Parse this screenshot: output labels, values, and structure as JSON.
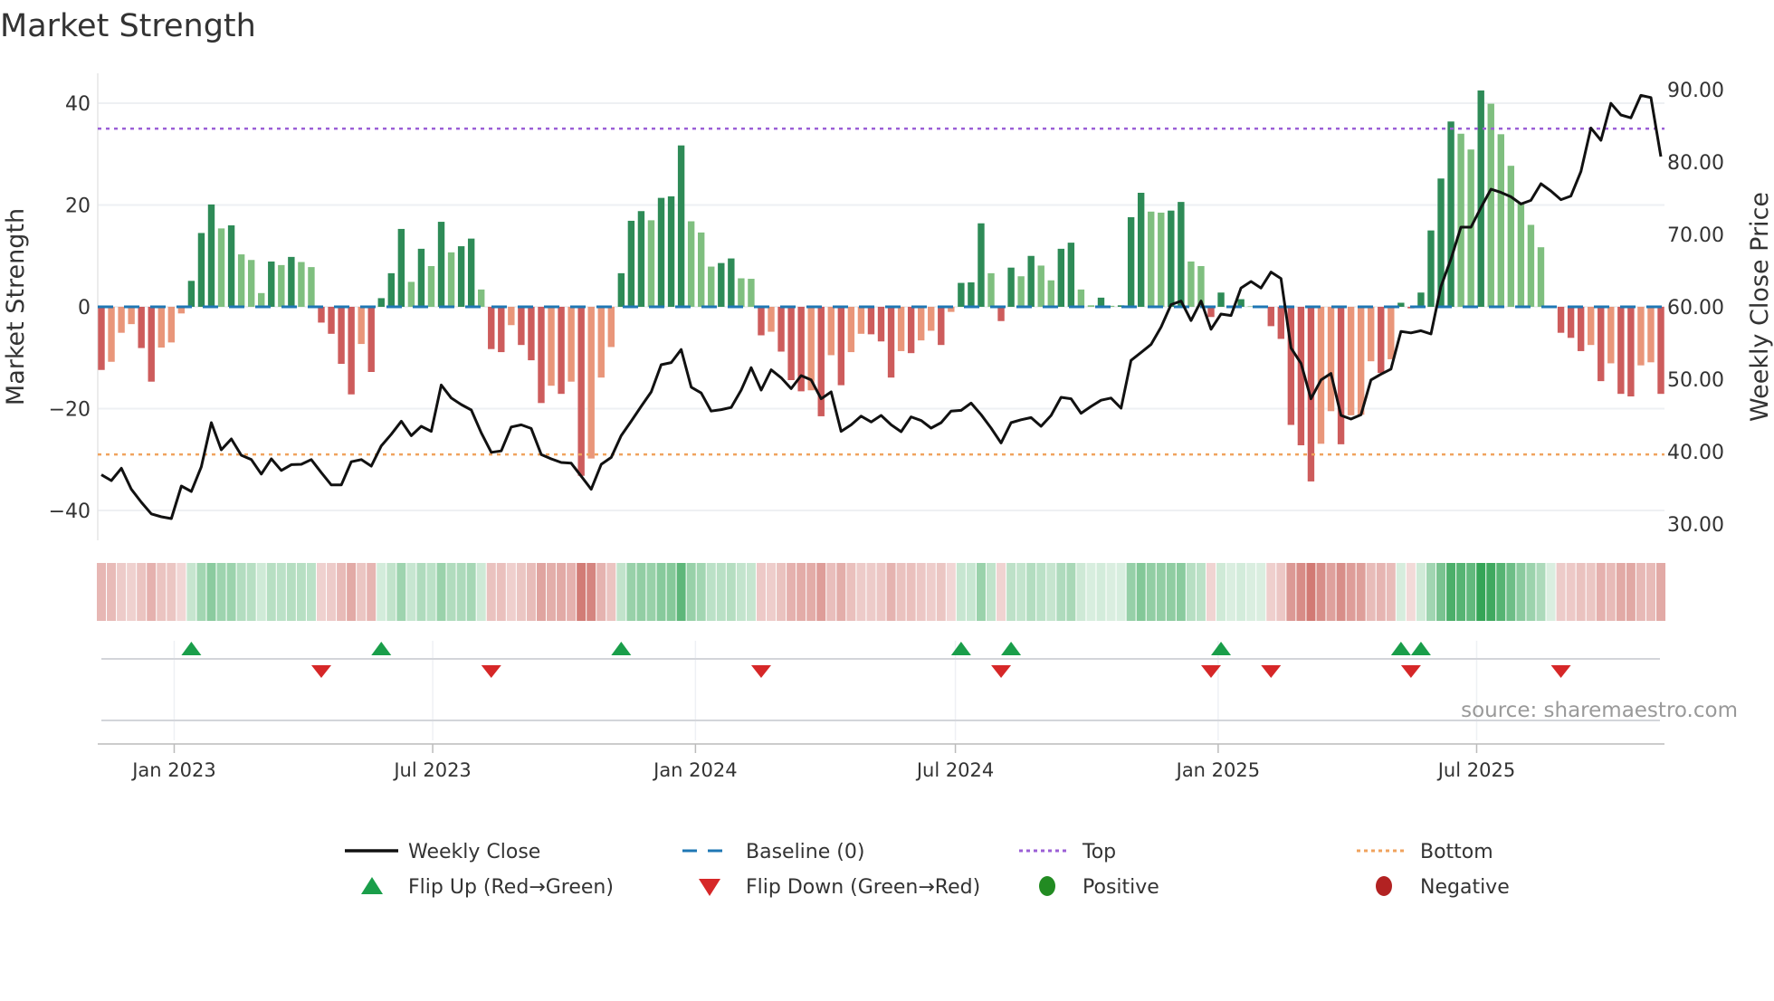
{
  "chart_data": {
    "type": "bar",
    "title": "Market Strength",
    "ylabel": "Market Strength",
    "ylabel_right": "Weekly Close Price",
    "source": "source: sharemaestro.com",
    "ylim": [
      -46,
      46
    ],
    "ylim_right": [
      27.75,
      92.25
    ],
    "yticks": [
      40,
      20,
      0,
      -20,
      -40
    ],
    "ytick_labels": [
      "40",
      "20",
      "0",
      "−20",
      "−40"
    ],
    "yticks_right": [
      90,
      80,
      70,
      60,
      50,
      40,
      30
    ],
    "ytick_right_labels": [
      "90.00",
      "80.00",
      "70.00",
      "60.00",
      "50.00",
      "40.00",
      "30.00"
    ],
    "x_start": "2022-11-11",
    "x_step_days": 7,
    "xticks": [
      "2023-01-01",
      "2023-07-01",
      "2024-01-01",
      "2024-07-01",
      "2025-01-01",
      "2025-07-01"
    ],
    "xtick_labels": [
      "Jan 2023",
      "Jul 2023",
      "Jan 2024",
      "Jul 2024",
      "Jan 2025",
      "Jul 2025"
    ],
    "grid": true,
    "top_level": 35,
    "bottom_level": -29,
    "baseline": 0,
    "colors": {
      "pos_strong": "#2e8b57",
      "pos_weak": "#7fbf7f",
      "neg_strong": "#cd5c5c",
      "neg_weak": "#e9967a",
      "price": "#111111",
      "baseline": "#1f77b4",
      "top": "#9b5fd6",
      "bottom": "#f0a35e",
      "flip_up": "#1a9e4a",
      "flip_down": "#d62728",
      "positive": "#228b22",
      "negative": "#b22222"
    },
    "series": [
      {
        "name": "Market Strength",
        "type": "bar",
        "values": [
          -12.4,
          -10.8,
          -5.1,
          -3.4,
          -8.1,
          -14.7,
          -8,
          -7,
          -1.3,
          5.1,
          14.5,
          20.1,
          15.4,
          16,
          10.3,
          9.2,
          2.7,
          8.9,
          8.2,
          9.8,
          8.8,
          7.8,
          -3.1,
          -5.3,
          -11.2,
          -17.2,
          -7.3,
          -12.8,
          1.7,
          6.6,
          15.3,
          4.9,
          11.4,
          8,
          16.7,
          10.7,
          11.9,
          13.4,
          3.4,
          -8.3,
          -8.9,
          -3.6,
          -7.5,
          -10.5,
          -18.9,
          -15.5,
          -17.1,
          -14.7,
          -33.2,
          -29.8,
          -13.9,
          -7.9,
          6.6,
          16.9,
          18.8,
          17,
          21.4,
          21.7,
          31.7,
          16.8,
          14.6,
          7.9,
          8.6,
          9.5,
          5.6,
          5.5,
          -5.6,
          -4.9,
          -8.8,
          -14.4,
          -16.6,
          -16.4,
          -21.5,
          -9.5,
          -15.4,
          -8.9,
          -5.3,
          -5.4,
          -6.8,
          -13.9,
          -8.7,
          -9.1,
          -6.6,
          -4.7,
          -7.5,
          -1,
          4.7,
          4.8,
          16.4,
          6.6,
          -2.8,
          7.7,
          6,
          10,
          8.1,
          5.2,
          11.4,
          12.6,
          3.4,
          0.3,
          1.8,
          0.2,
          0.3,
          17.6,
          22.4,
          18.7,
          18.5,
          18.9,
          20.6,
          8.9,
          8,
          -2,
          2.8,
          0.1,
          1.5,
          0.1,
          0.1,
          -3.8,
          -6.3,
          -23.2,
          -27.2,
          -34.3,
          -26.9,
          -20.5,
          -27,
          -21.3,
          -21.2,
          -10.7,
          -13,
          -10.3,
          0.8,
          -0.3,
          2.8,
          15,
          25.2,
          36.4,
          34,
          30.9,
          42.5,
          39.9,
          33.9,
          27.7,
          20.3,
          16.1,
          11.7,
          0.1,
          -5.1,
          -6.1,
          -8.7,
          -7.5,
          -14.6,
          -11.1,
          -17.1,
          -17.6,
          -11.5,
          -10.9,
          -17.1
        ]
      },
      {
        "name": "Weekly Close",
        "type": "line",
        "axis": "right",
        "values": [
          36.8,
          36.0,
          37.7,
          34.8,
          33.0,
          31.4,
          31.0,
          30.75,
          35.25,
          34.5,
          37.9,
          44.0,
          40.25,
          41.75,
          39.5,
          38.9,
          36.9,
          39,
          37.4,
          38.2,
          38.25,
          38.9,
          37.1,
          35.4,
          35.4,
          38.6,
          38.9,
          38.0,
          40.8,
          42.4,
          44.2,
          42.2,
          43.5,
          42.8,
          49.2,
          47.4,
          46.5,
          45.75,
          42.6,
          39.9,
          40.1,
          43.4,
          43.7,
          43.2,
          39.6,
          39,
          38.5,
          38.4,
          36.6,
          34.8,
          38.25,
          39.2,
          42.2,
          44.2,
          46.25,
          48.25,
          52,
          52.3,
          54.1,
          48.9,
          48.1,
          45.6,
          45.8,
          46.1,
          48.5,
          51.6,
          48.5,
          51.3,
          50.2,
          48.7,
          50.5,
          49.9,
          47.3,
          48.25,
          42.8,
          43.7,
          44.9,
          44.1,
          45,
          43.7,
          42.75,
          44.8,
          44.3,
          43.25,
          44,
          45.6,
          45.7,
          46.7,
          45.1,
          43.25,
          41.2,
          44,
          44.4,
          44.7,
          43.5,
          45,
          47.5,
          47.3,
          45.3,
          46.25,
          47.1,
          47.4,
          46,
          52.6,
          53.7,
          54.8,
          57.2,
          60.3,
          60.8,
          58.1,
          60.8,
          56.9,
          59.0,
          58.8,
          62.6,
          63.5,
          62.6,
          64.8,
          63.9,
          54.3,
          52.2,
          47.3,
          49.9,
          50.8,
          45.0,
          44.5,
          45.1,
          49.9,
          50.7,
          51.4,
          56.6,
          56.4,
          56.7,
          56.25,
          62.8,
          66.6,
          71.0,
          71.0,
          73.7,
          76.25,
          75.8,
          75.2,
          74.2,
          74.7,
          77,
          76,
          74.8,
          75.3,
          78.7,
          84.7,
          83,
          88.1,
          86.5,
          86.1,
          89.2,
          88.9,
          80.75
        ]
      }
    ],
    "flip_up_weeks": [
      10,
      29,
      53,
      87,
      92,
      113,
      131,
      133
    ],
    "flip_down_weeks": [
      23,
      40,
      67,
      91,
      112,
      118,
      132,
      147
    ],
    "legend": {
      "placement": "bottom",
      "items": [
        {
          "label": "Weekly Close"
        },
        {
          "label": "Baseline (0)"
        },
        {
          "label": "Top"
        },
        {
          "label": "Bottom"
        },
        {
          "label": "Flip Up (Red→Green)"
        },
        {
          "label": "Flip Down (Green→Red)"
        },
        {
          "label": "Positive"
        },
        {
          "label": "Negative"
        }
      ]
    }
  }
}
